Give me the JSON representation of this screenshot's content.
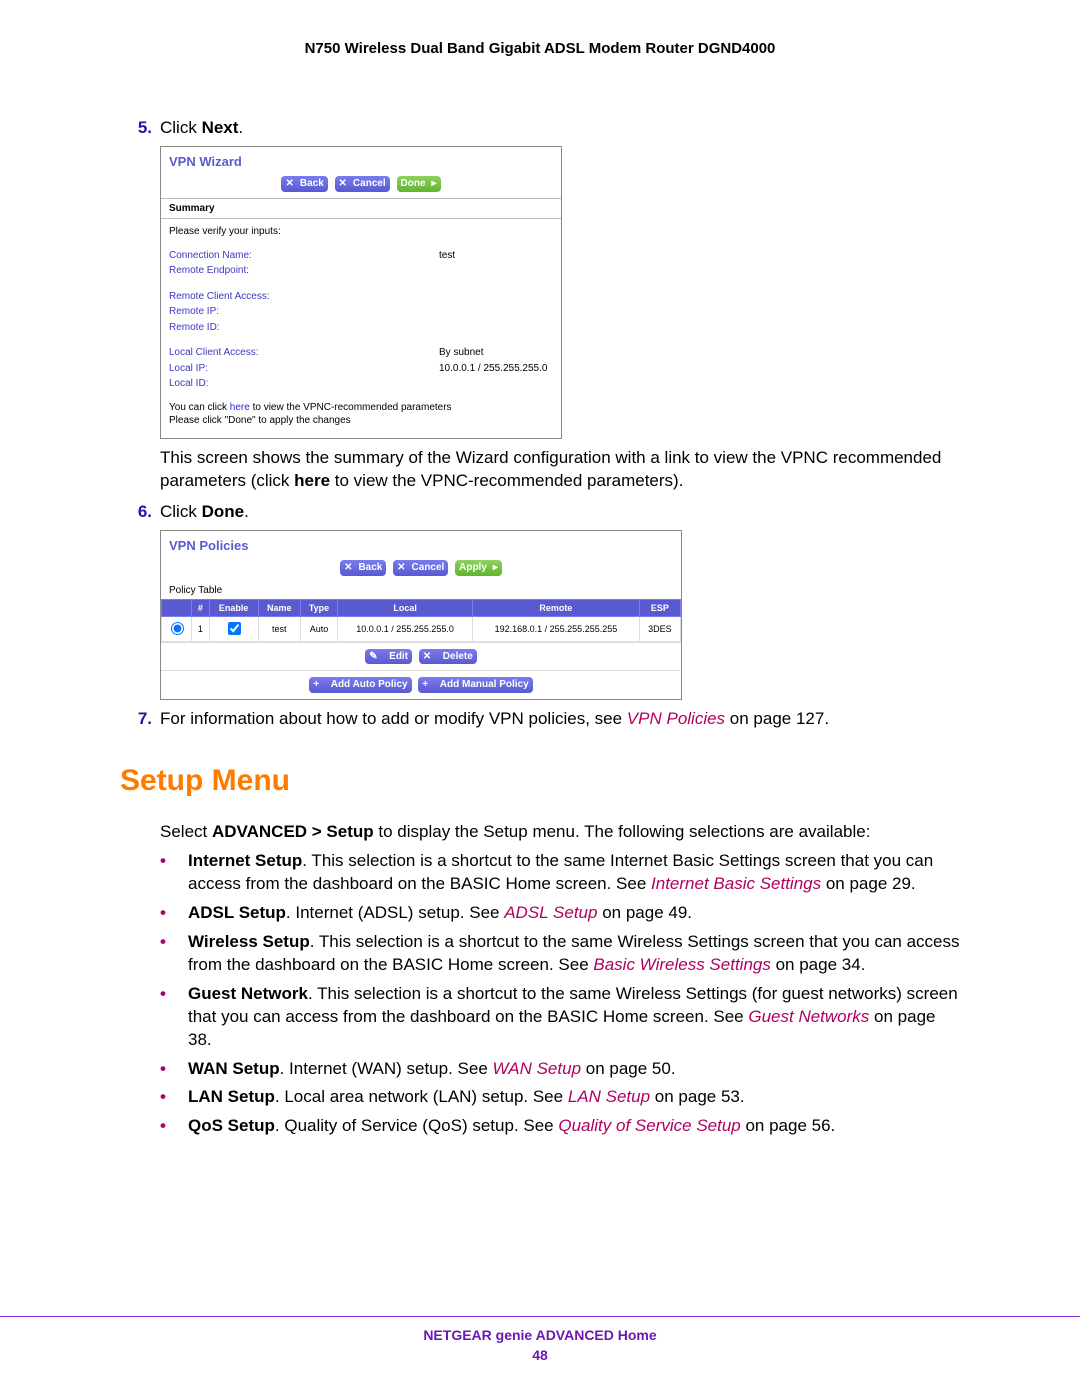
{
  "header": "N750 Wireless Dual Band Gigabit ADSL Modem Router DGND4000",
  "steps": {
    "s5_num": "5.",
    "s5_text_a": "Click ",
    "s5_bold": "Next",
    "s5_text_b": ".",
    "s5_summary": "This screen shows the summary of the Wizard configuration with a link to view the VPNC recommended parameters (click ",
    "s5_summary_bold": "here",
    "s5_summary2": " to view the VPNC-recommended parameters).",
    "s6_num": "6.",
    "s6_text_a": "Click ",
    "s6_bold": "Done",
    "s6_text_b": ".",
    "s7_num": "7.",
    "s7_text_a": "For information about how to add or modify VPN policies, see ",
    "s7_link": "VPN Policies",
    "s7_text_b": " on page 127."
  },
  "wizard": {
    "title": "VPN Wizard",
    "back": "Back",
    "cancel": "Cancel",
    "done": "Done",
    "summary": "Summary",
    "verify": "Please verify your inputs:",
    "conn_name_lbl": "Connection Name:",
    "conn_name_val": "test",
    "remote_endpoint_lbl": "Remote Endpoint:",
    "remote_client_lbl": "Remote Client Access:",
    "remote_ip_lbl": "Remote IP:",
    "remote_id_lbl": "Remote ID:",
    "local_client_lbl": "Local Client Access:",
    "local_client_val": "By subnet",
    "local_ip_lbl": "Local IP:",
    "local_ip_val": "10.0.0.1 / 255.255.255.0",
    "local_id_lbl": "Local ID:",
    "note1a": "You can click ",
    "note1_here": "here",
    "note1b": " to view the VPNC-recommended parameters",
    "note2": "Please click \"Done\" to apply the changes"
  },
  "policies": {
    "title": "VPN Policies",
    "back": "Back",
    "cancel": "Cancel",
    "apply": "Apply",
    "policy_table": "Policy Table",
    "h_num": "#",
    "h_enable": "Enable",
    "h_name": "Name",
    "h_type": "Type",
    "h_local": "Local",
    "h_remote": "Remote",
    "h_esp": "ESP",
    "row_num": "1",
    "row_name": "test",
    "row_type": "Auto",
    "row_local": "10.0.0.1 / 255.255.255.0",
    "row_remote": "192.168.0.1 / 255.255.255.255",
    "row_esp": "3DES",
    "edit": "Edit",
    "delete": "Delete",
    "add_auto": "Add Auto Policy",
    "add_manual": "Add Manual Policy"
  },
  "setup": {
    "heading": "Setup Menu",
    "intro_a": "Select ",
    "intro_bold": "ADVANCED > Setup",
    "intro_b": " to display the Setup menu. The following selections are available:",
    "b1_bold": "Internet Setup",
    "b1_a": ". This selection is a shortcut to the same Internet Basic Settings screen that you can access from the dashboard on the BASIC Home screen. See ",
    "b1_link": "Internet Basic Settings",
    "b1_b": " on page 29.",
    "b2_bold": "ADSL Setup",
    "b2_a": ". Internet (ADSL) setup. See ",
    "b2_link": "ADSL Setup",
    "b2_b": " on page 49.",
    "b3_bold": "Wireless Setup",
    "b3_a": ". This selection is a shortcut to the same Wireless Settings screen that you can access from the dashboard on the BASIC Home screen. See ",
    "b3_link": "Basic Wireless Settings",
    "b3_b": " on page 34.",
    "b4_bold": "Guest Network",
    "b4_a": ". This selection is a shortcut to the same Wireless Settings (for guest networks) screen that you can access from the dashboard on the BASIC Home screen. See ",
    "b4_link": "Guest Networks",
    "b4_b": " on page 38.",
    "b5_bold": "WAN Setup",
    "b5_a": ". Internet (WAN) setup. See ",
    "b5_link": "WAN Setup",
    "b5_b": " on page 50.",
    "b6_bold": "LAN Setup",
    "b6_a": ". Local area network (LAN) setup. See ",
    "b6_link": "LAN Setup",
    "b6_b": " on page 53.",
    "b7_bold": "QoS Setup",
    "b7_a": ". Quality of Service (QoS) setup. See ",
    "b7_link": "Quality of Service Setup",
    "b7_b": " on page 56."
  },
  "footer": {
    "title": "NETGEAR genie ADVANCED Home",
    "page": "48"
  }
}
